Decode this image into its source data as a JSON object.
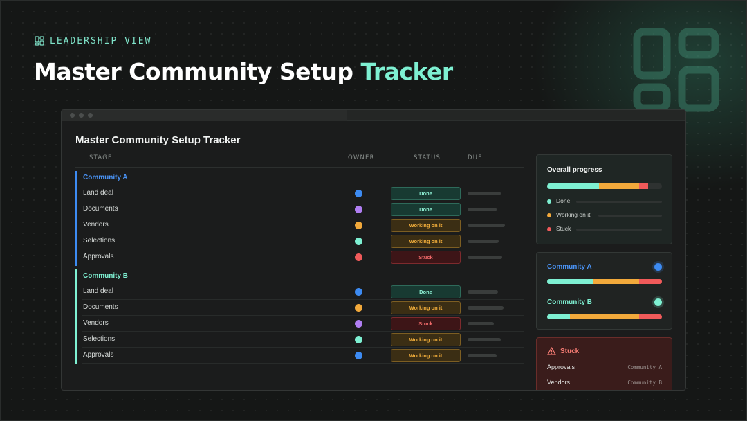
{
  "header": {
    "eyebrow": "LEADERSHIP VIEW",
    "title_main": "Master Community Setup",
    "title_accent": "Tracker"
  },
  "window": {
    "title": "Master Community Setup Tracker",
    "columns": {
      "stage": "STAGE",
      "owner": "OWNER",
      "status": "STATUS",
      "due": "DUE"
    }
  },
  "colors": {
    "done": "#7ef0d2",
    "working": "#f2a93b",
    "stuck": "#f05a5a",
    "community_a": "#3d8bf2",
    "community_b": "#7ef0d2",
    "owner_blue": "#3d8bf2",
    "owner_purple": "#b07ef2",
    "owner_orange": "#f2a93b",
    "owner_teal": "#7ef0d2",
    "owner_red": "#f05a5a"
  },
  "groups": [
    {
      "name": "Community A",
      "rows": [
        {
          "stage": "Land deal",
          "owner": "owner_blue",
          "status": "Done",
          "kind": "done",
          "due": 0.75
        },
        {
          "stage": "Documents",
          "owner": "owner_purple",
          "status": "Done",
          "kind": "done",
          "due": 0.65
        },
        {
          "stage": "Vendors",
          "owner": "owner_orange",
          "status": "Working on it",
          "kind": "working",
          "due": 0.85
        },
        {
          "stage": "Selections",
          "owner": "owner_teal",
          "status": "Working on it",
          "kind": "working",
          "due": 0.7
        },
        {
          "stage": "Approvals",
          "owner": "owner_red",
          "status": "Stuck",
          "kind": "stuck",
          "due": 0.78
        }
      ]
    },
    {
      "name": "Community B",
      "rows": [
        {
          "stage": "Land deal",
          "owner": "owner_blue",
          "status": "Done",
          "kind": "done",
          "due": 0.68
        },
        {
          "stage": "Documents",
          "owner": "owner_orange",
          "status": "Working on it",
          "kind": "working",
          "due": 0.82
        },
        {
          "stage": "Vendors",
          "owner": "owner_purple",
          "status": "Stuck",
          "kind": "stuck",
          "due": 0.6
        },
        {
          "stage": "Selections",
          "owner": "owner_teal",
          "status": "Working on it",
          "kind": "working",
          "due": 0.75
        },
        {
          "stage": "Approvals",
          "owner": "owner_blue",
          "status": "Working on it",
          "kind": "working",
          "due": 0.65
        }
      ]
    }
  ],
  "overall": {
    "title": "Overall progress",
    "segments": {
      "done": 0.45,
      "working": 0.35,
      "stuck": 0.08
    },
    "legend": [
      "Done",
      "Working on it",
      "Stuck"
    ]
  },
  "communities": [
    {
      "name": "Community A",
      "segments": {
        "done": 0.4,
        "working": 0.4,
        "stuck": 0.2
      }
    },
    {
      "name": "Community B",
      "segments": {
        "done": 0.2,
        "working": 0.6,
        "stuck": 0.2
      }
    }
  ],
  "stuck_panel": {
    "title": "Stuck",
    "items": [
      {
        "stage": "Approvals",
        "community": "Community A"
      },
      {
        "stage": "Vendors",
        "community": "Community B"
      }
    ]
  }
}
